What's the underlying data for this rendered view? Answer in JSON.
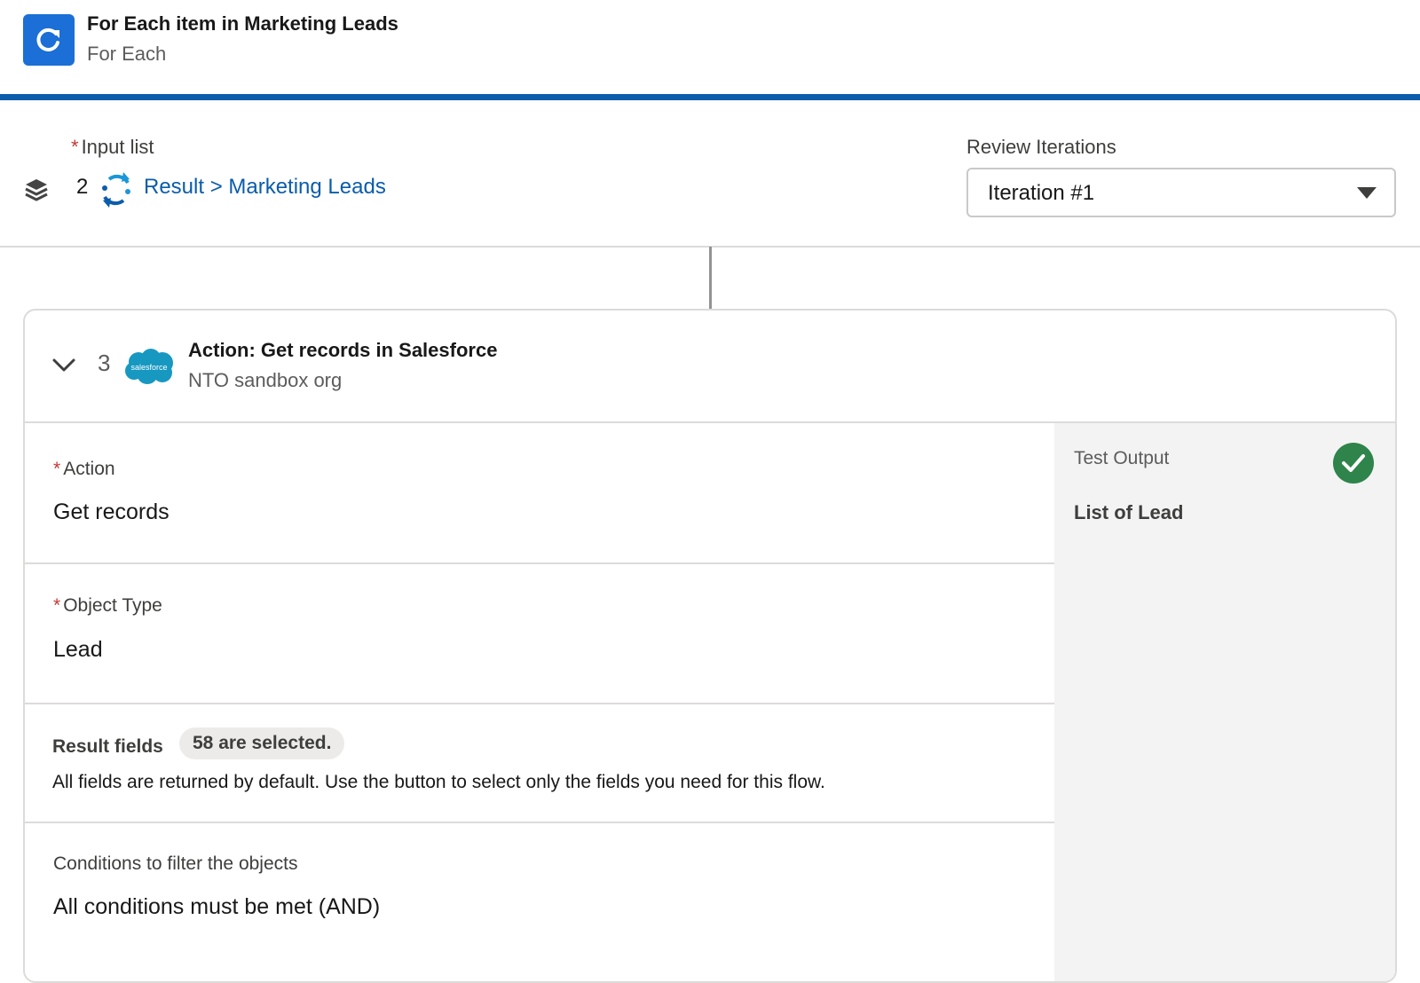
{
  "header": {
    "title": "For Each item in Marketing Leads",
    "subtitle": "For Each",
    "icon": "refresh-icon",
    "accent_color": "#0b5cab"
  },
  "input_list": {
    "label": "Input list",
    "required_marker": "*",
    "step_number": "2",
    "link_text": "Result > Marketing Leads"
  },
  "review": {
    "label": "Review Iterations",
    "selected": "Iteration #1"
  },
  "card": {
    "step_number": "3",
    "title": "Action: Get records in Salesforce",
    "subtitle": "NTO sandbox org",
    "logo_text": "salesforce",
    "fields": {
      "action": {
        "label": "Action",
        "required_marker": "*",
        "value": "Get records"
      },
      "object_type": {
        "label": "Object Type",
        "required_marker": "*",
        "value": "Lead"
      },
      "result_fields": {
        "label": "Result fields",
        "badge": "58 are selected.",
        "help": "All fields are returned by default. Use the button to select only the fields you need for this flow."
      },
      "conditions": {
        "label": "Conditions to filter the objects",
        "value": "All conditions must be met (AND)"
      }
    },
    "output": {
      "label": "Test Output",
      "value": "List of Lead",
      "status_color": "#2e844a"
    }
  }
}
